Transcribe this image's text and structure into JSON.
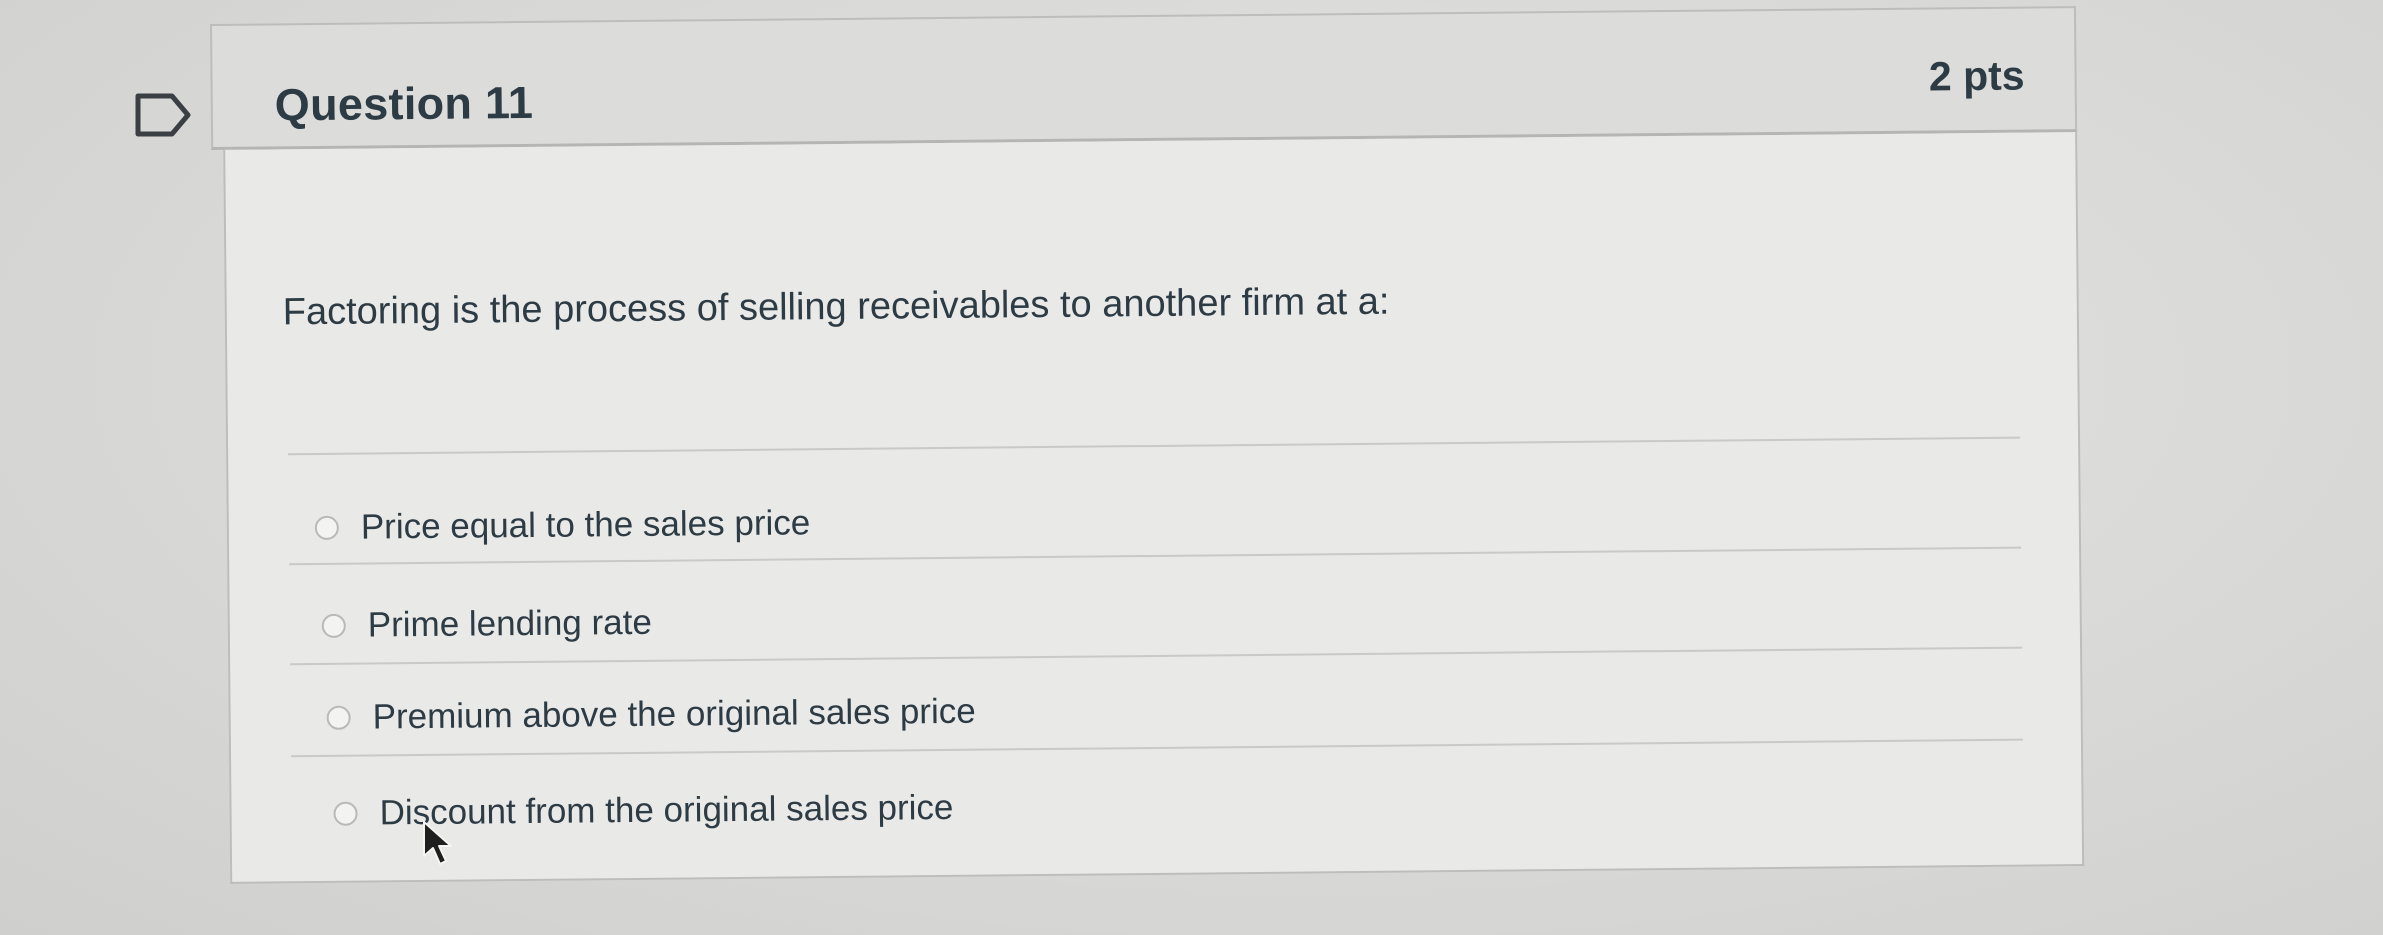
{
  "question": {
    "title": "Question 11",
    "points": "2 pts",
    "text": "Factoring is the process of selling receivables to another firm at a:",
    "answers": [
      {
        "label": "Price equal to the sales price",
        "selected": false
      },
      {
        "label": "Prime lending rate",
        "selected": false
      },
      {
        "label": "Premium above the original sales price",
        "selected": false
      },
      {
        "label": "Discount from the original sales price",
        "selected": false
      }
    ]
  },
  "icons": {
    "flag": "bookmark-flag-icon",
    "cursor": "mouse-pointer-icon"
  },
  "colors": {
    "text": "#2d3b45",
    "header_bg": "#dcdcda",
    "body_bg": "#e9e9e7",
    "border": "#bdbdbb"
  }
}
